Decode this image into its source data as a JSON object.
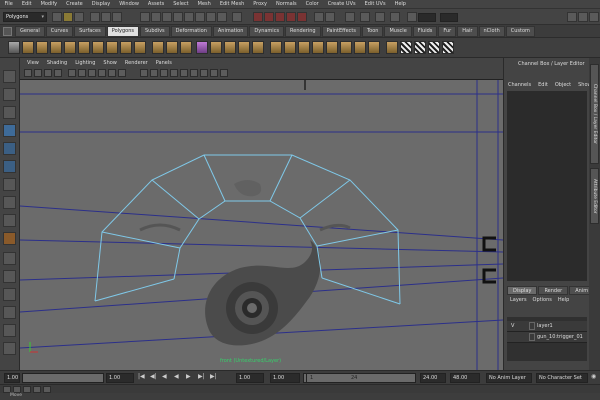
{
  "menubar": [
    "File",
    "Edit",
    "Modify",
    "Create",
    "Display",
    "Window",
    "Assets",
    "Select",
    "Mesh",
    "Edit Mesh",
    "Proxy",
    "Normals",
    "Color",
    "Create UVs",
    "Edit UVs",
    "Help"
  ],
  "statusline": {
    "mode": "Polygons"
  },
  "shelf_tabs": [
    "General",
    "Curves",
    "Surfaces",
    "Polygons",
    "Subdivs",
    "Deformation",
    "Animation",
    "Dynamics",
    "Rendering",
    "PaintEffects",
    "Toon",
    "Muscle",
    "Fluids",
    "Fur",
    "Hair",
    "nCloth",
    "Custom"
  ],
  "active_shelf": "Polygons",
  "panel_menu": [
    "View",
    "Shading",
    "Lighting",
    "Show",
    "Renderer",
    "Panels"
  ],
  "viewport": {
    "camera_label": "front (Untextured/Layer)"
  },
  "channel_box": {
    "title": "Channel Box / Layer Editor",
    "menu": [
      "Channels",
      "Edit",
      "Object",
      "Show"
    ],
    "layer_tabs": [
      "Display",
      "Render",
      "Anim"
    ],
    "layer_menu": [
      "Layers",
      "Options",
      "Help"
    ],
    "layers": [
      {
        "visibility": "V",
        "name": "layer1"
      },
      {
        "visibility": "",
        "name": "gun_10:trigger_01"
      }
    ]
  },
  "side_tabs": [
    "Channel Box / Layer Editor",
    "Attribute Editor"
  ],
  "timeline": {
    "start": "1.00",
    "range_start": "1.00",
    "current": "1",
    "range_end": "24",
    "end": "24.00",
    "end2": "48.00",
    "anim_layer": "No Anim Layer",
    "char_set": "No Character Set",
    "field_a": "1.00"
  },
  "helpline": "Move"
}
